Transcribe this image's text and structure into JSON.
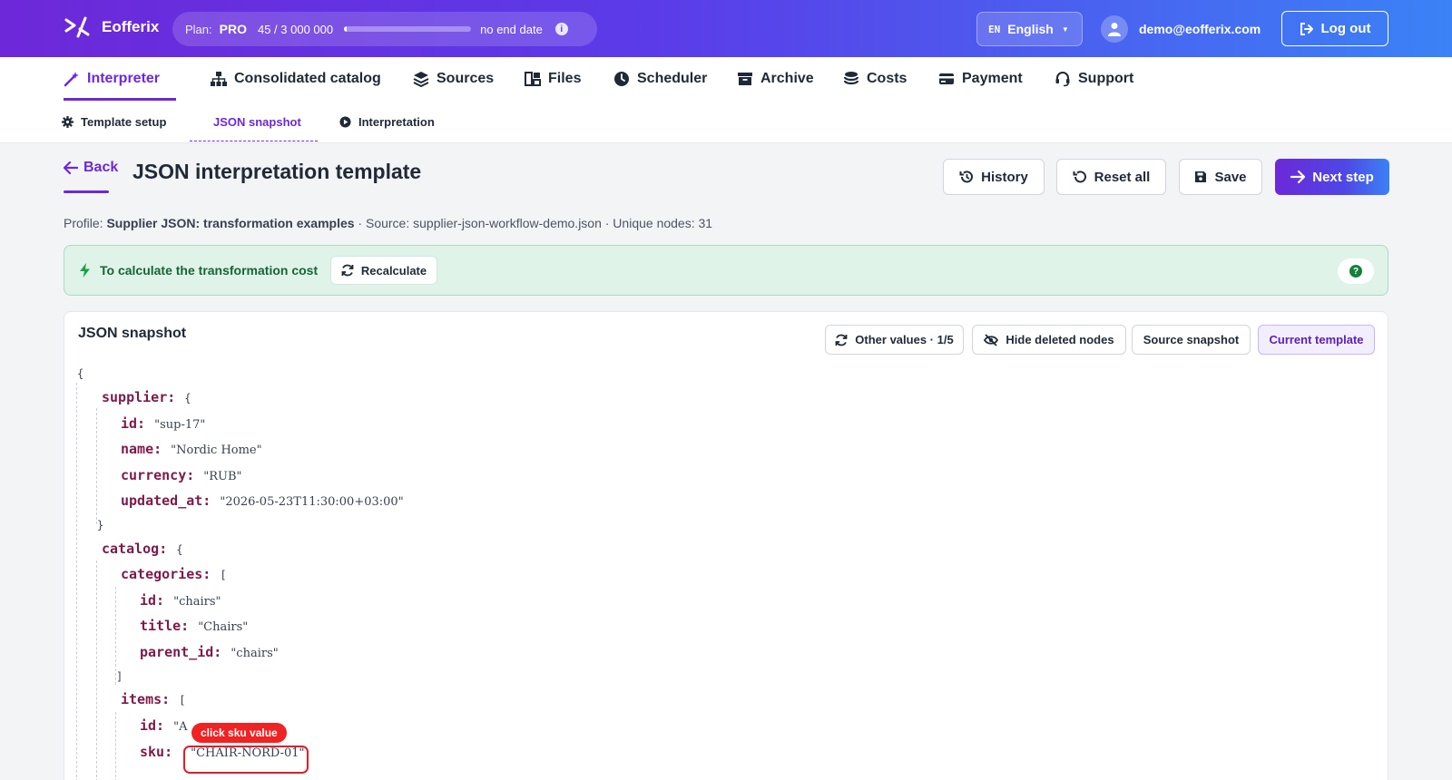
{
  "header": {
    "brand": "Eofferix",
    "plan": {
      "label": "Plan:",
      "tier": "PRO",
      "usage": "45 / 3 000 000",
      "usage_fraction": 1.5e-05,
      "end": "no end date"
    },
    "language": {
      "code": "EN",
      "name": "English"
    },
    "user_email": "demo@eofferix.com",
    "logout_label": "Log out"
  },
  "nav": {
    "items": [
      {
        "label": "Interpreter",
        "icon": "magic-wand-icon",
        "active": true
      },
      {
        "label": "Consolidated catalog",
        "icon": "sitemap-icon"
      },
      {
        "label": "Sources",
        "icon": "layers-icon"
      },
      {
        "label": "Files",
        "icon": "files-icon"
      },
      {
        "label": "Scheduler",
        "icon": "clock-icon"
      },
      {
        "label": "Archive",
        "icon": "archive-icon"
      },
      {
        "label": "Costs",
        "icon": "coins-icon"
      },
      {
        "label": "Payment",
        "icon": "card-icon"
      },
      {
        "label": "Support",
        "icon": "headset-icon"
      }
    ]
  },
  "subnav": {
    "items": [
      {
        "label": "Template setup",
        "icon": "gear-icon"
      },
      {
        "label": "JSON snapshot",
        "active": true
      },
      {
        "label": "Interpretation",
        "icon": "play-circle-icon"
      }
    ]
  },
  "page": {
    "back_label": "Back",
    "title": "JSON interpretation template",
    "buttons": {
      "history": "History",
      "reset": "Reset all",
      "save": "Save",
      "next": "Next step"
    },
    "profile": {
      "prefix": "Profile:",
      "name": "Supplier JSON: transformation examples",
      "rest": " · Source: supplier-json-workflow-demo.json · Unique nodes: 31"
    }
  },
  "banner": {
    "text": "To calculate the transformation cost",
    "recalculate": "Recalculate",
    "help": "?"
  },
  "snapshot": {
    "title": "JSON snapshot",
    "buttons": {
      "other_values": "Other values · 1/5",
      "hide_deleted": "Hide deleted nodes",
      "source": "Source snapshot",
      "current": "Current template"
    },
    "lines": {
      "open": "{",
      "supplier_key": "supplier:",
      "supplier_open": "{",
      "id_key": "id:",
      "id_val": "\"sup-17\"",
      "name_key": "name:",
      "name_val": "\"Nordic Home\"",
      "currency_key": "currency:",
      "currency_val": "\"RUB\"",
      "updated_key": "updated_at:",
      "updated_val": "\"2026-05-23T11:30:00+03:00\"",
      "supplier_close": "}",
      "catalog_key": "catalog:",
      "catalog_open": "{",
      "categories_key": "categories:",
      "categories_open": "[",
      "cat_id_key": "id:",
      "cat_id_val": "\"chairs\"",
      "cat_title_key": "title:",
      "cat_title_val": "\"Chairs\"",
      "cat_parent_key": "parent_id:",
      "cat_parent_val": "\"chairs\"",
      "categories_close": "]",
      "items_key": "items:",
      "items_open": "[",
      "item_id_key": "id:",
      "item_id_val": "\"A",
      "sku_key": "sku:",
      "sku_val": "\"CHAIR-NORD-01\""
    },
    "hint": "click sku value"
  }
}
